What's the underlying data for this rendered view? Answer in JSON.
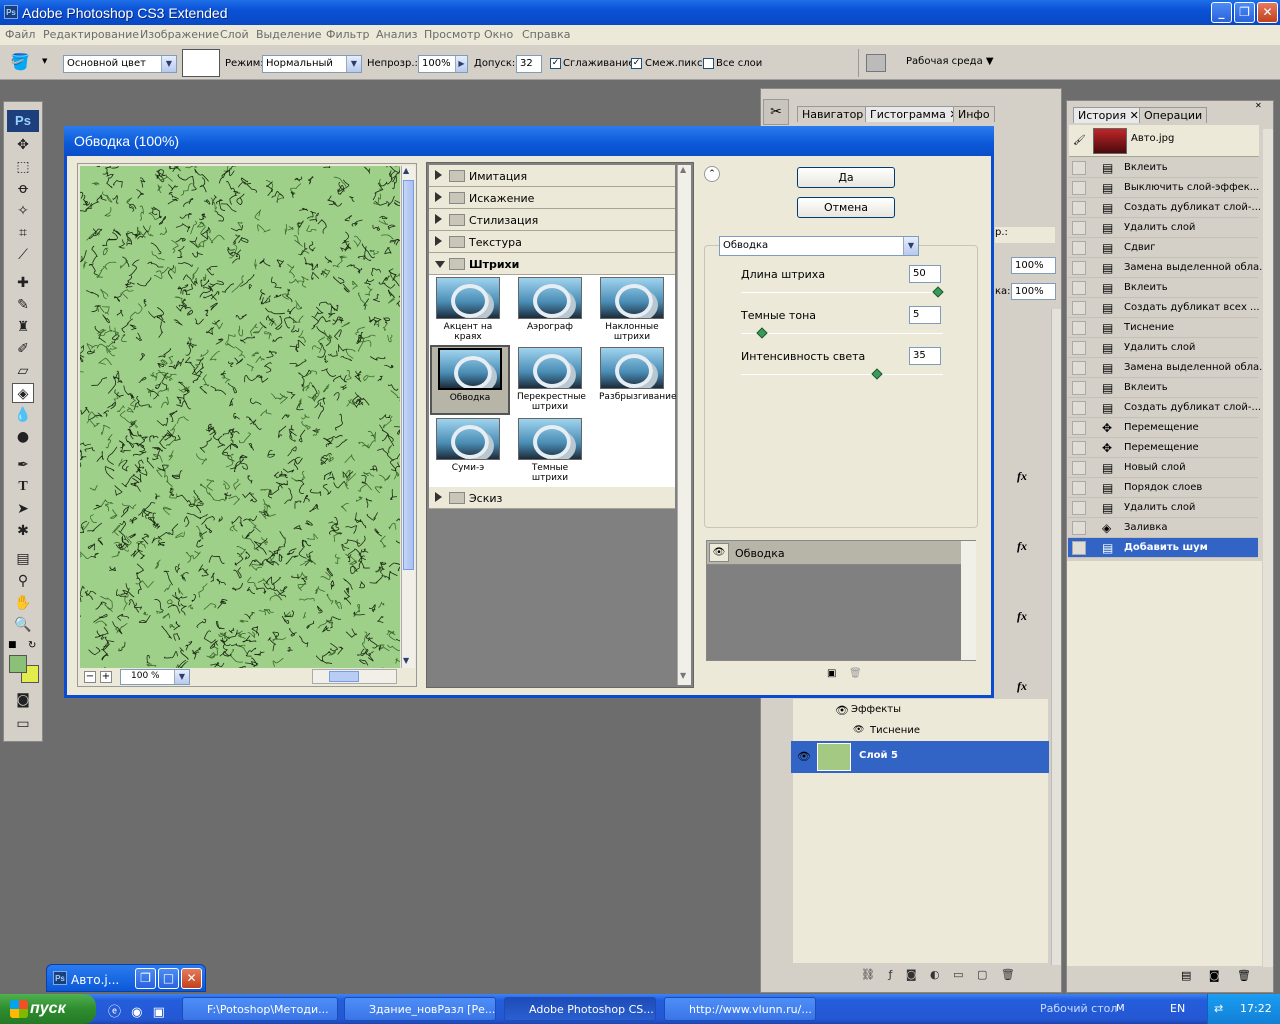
{
  "window": {
    "title": "Adobe Photoshop CS3 Extended",
    "icon": "Ps"
  },
  "menu": [
    "Файл",
    "Редактирование",
    "Изображение",
    "Слой",
    "Выделение",
    "Фильтр",
    "Анализ",
    "Просмотр",
    "Окно",
    "Справка"
  ],
  "options": {
    "source": "Основной цвет",
    "mode_label": "Режим:",
    "mode": "Нормальный",
    "opacity_label": "Непрозр.:",
    "opacity": "100%",
    "tolerance_label": "Допуск:",
    "tolerance": "32",
    "antialias": "Сглаживание",
    "contiguous": "Смеж.пикс",
    "all_layers": "Все слои",
    "workspace": "Рабочая среда"
  },
  "dialog": {
    "title": "Обводка (100%)",
    "zoom": "100 %",
    "folders_top": [
      "Имитация",
      "Искажение",
      "Стилизация",
      "Текстура"
    ],
    "open_folder": "Штрихи",
    "thumbs": [
      [
        "Акцент на краях"
      ],
      [
        "Аэрограф"
      ],
      [
        "Наклонные",
        "штрихи"
      ],
      [
        "Обводка"
      ],
      [
        "Перекрестные",
        "штрихи"
      ],
      [
        "Разбрызгивание"
      ],
      [
        "Суми-э"
      ],
      [
        "Темные штрихи"
      ]
    ],
    "folder_bottom": "Эскиз",
    "ok": "Да",
    "cancel": "Отмена",
    "filter_select": "Обводка",
    "params": [
      {
        "label": "Длина штриха",
        "value": "50",
        "fraction": 1.0
      },
      {
        "label": "Темные тона",
        "value": "5",
        "fraction": 0.1
      },
      {
        "label": "Интенсивность света",
        "value": "35",
        "fraction": 0.69
      }
    ],
    "layer_effect": "Обводка"
  },
  "nav_panel": {
    "tabs": [
      "Навигатор",
      "Гистограмма",
      "Инфо"
    ]
  },
  "layers_panel": {
    "opacity1": "100%",
    "opacity2": "100%",
    "frag1": "р.:",
    "frag2": "ка:",
    "fx": "fx",
    "effects": "Эффекты",
    "emboss": "Тиснение",
    "layer": "Слой 5",
    "fill_color": "#a3c983"
  },
  "history_panel": {
    "tabs": [
      "История",
      "Операции"
    ],
    "snapshot": "Авто.jpg",
    "items": [
      {
        "label": "Вклеить",
        "icon": "doc"
      },
      {
        "label": "Выключить слой-эффек...",
        "icon": "doc"
      },
      {
        "label": "Создать дубликат слой-...",
        "icon": "doc"
      },
      {
        "label": "Удалить слой",
        "icon": "doc"
      },
      {
        "label": "Сдвиг",
        "icon": "doc"
      },
      {
        "label": "Замена выделенной обла...",
        "icon": "doc"
      },
      {
        "label": "Вклеить",
        "icon": "doc"
      },
      {
        "label": "Создать дубликат всех ...",
        "icon": "doc"
      },
      {
        "label": "Тиснение",
        "icon": "doc"
      },
      {
        "label": "Удалить слой",
        "icon": "doc"
      },
      {
        "label": "Замена выделенной обла...",
        "icon": "doc"
      },
      {
        "label": "Вклеить",
        "icon": "doc"
      },
      {
        "label": "Создать дубликат слой-...",
        "icon": "doc"
      },
      {
        "label": "Перемещение",
        "icon": "move"
      },
      {
        "label": "Перемещение",
        "icon": "move"
      },
      {
        "label": "Новый слой",
        "icon": "doc"
      },
      {
        "label": "Порядок слоев",
        "icon": "doc"
      },
      {
        "label": "Удалить слой",
        "icon": "doc"
      },
      {
        "label": "Заливка",
        "icon": "bucket"
      },
      {
        "label": "Добавить шум",
        "icon": "doc"
      }
    ]
  },
  "minidoc": {
    "title": "Авто.j..."
  },
  "taskbar": {
    "start": "пуск",
    "tasks": [
      "F:\\Potoshop\\Методи...",
      "Здание_новРазл [Ре...",
      "Adobe Photoshop CS...",
      "http://www.vlunn.ru/..."
    ],
    "desktop": "Рабочий стол",
    "m": "M",
    "lang": "EN",
    "time": "17:22"
  }
}
